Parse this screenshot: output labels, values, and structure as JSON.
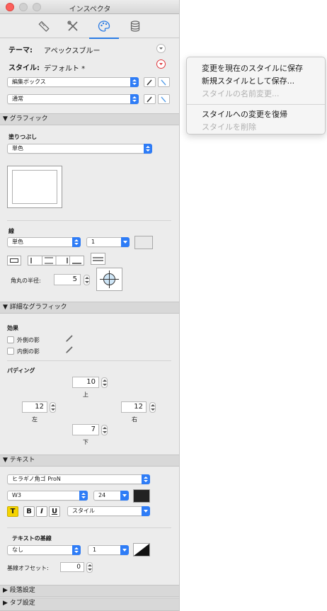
{
  "window": {
    "title": "インスペクタ"
  },
  "tabs": [
    {
      "icon": "ruler-icon"
    },
    {
      "icon": "tools-icon"
    },
    {
      "icon": "palette-icon",
      "active": true
    },
    {
      "icon": "database-icon"
    }
  ],
  "theme": {
    "label": "テーマ:",
    "value": "アペックスブルー"
  },
  "style": {
    "label": "スタイル:",
    "value": "デフォルト *"
  },
  "style_selects": [
    "編集ボックス",
    "通常"
  ],
  "graphics": {
    "header": "▼ グラフィック",
    "fill_label": "塗りつぶし",
    "fill_value": "単色",
    "line_label": "線",
    "line_type": "単色",
    "line_width": "1",
    "corner_label": "角丸の半径:",
    "corner_value": "5"
  },
  "advanced": {
    "header": "▼ 詳細なグラフィック",
    "effects_label": "効果",
    "outer_shadow": "外側の影",
    "inner_shadow": "内側の影",
    "padding_label": "パディング",
    "top_value": "10",
    "top_label": "上",
    "left_value": "12",
    "left_label": "左",
    "right_value": "12",
    "right_label": "右",
    "bottom_value": "7",
    "bottom_label": "下"
  },
  "text": {
    "header": "▼ テキスト",
    "font": "ヒラギノ角ゴ ProN",
    "weight": "W3",
    "size": "24",
    "bold": "B",
    "italic": "I",
    "underline": "U",
    "t_button": "T",
    "style_select": "スタイル",
    "baseline_label": "テキストの基線",
    "baseline_type": "なし",
    "baseline_width": "1",
    "offset_label": "基線オフセット:",
    "offset_value": "0"
  },
  "collapsed": [
    "▶ 段落設定",
    "▶ タブ設定"
  ],
  "context_menu": {
    "items": [
      {
        "label": "変更を現在のスタイルに保存",
        "enabled": true
      },
      {
        "label": "新規スタイルとして保存...",
        "enabled": true
      },
      {
        "label": "スタイルの名前変更...",
        "enabled": false
      },
      {
        "label": "スタイルへの変更を復帰",
        "enabled": true
      },
      {
        "label": "スタイルを削除",
        "enabled": false
      }
    ]
  },
  "colors": {
    "accent": "#2e7cf6",
    "close": "#fc605c",
    "alert": "#e0393e"
  }
}
